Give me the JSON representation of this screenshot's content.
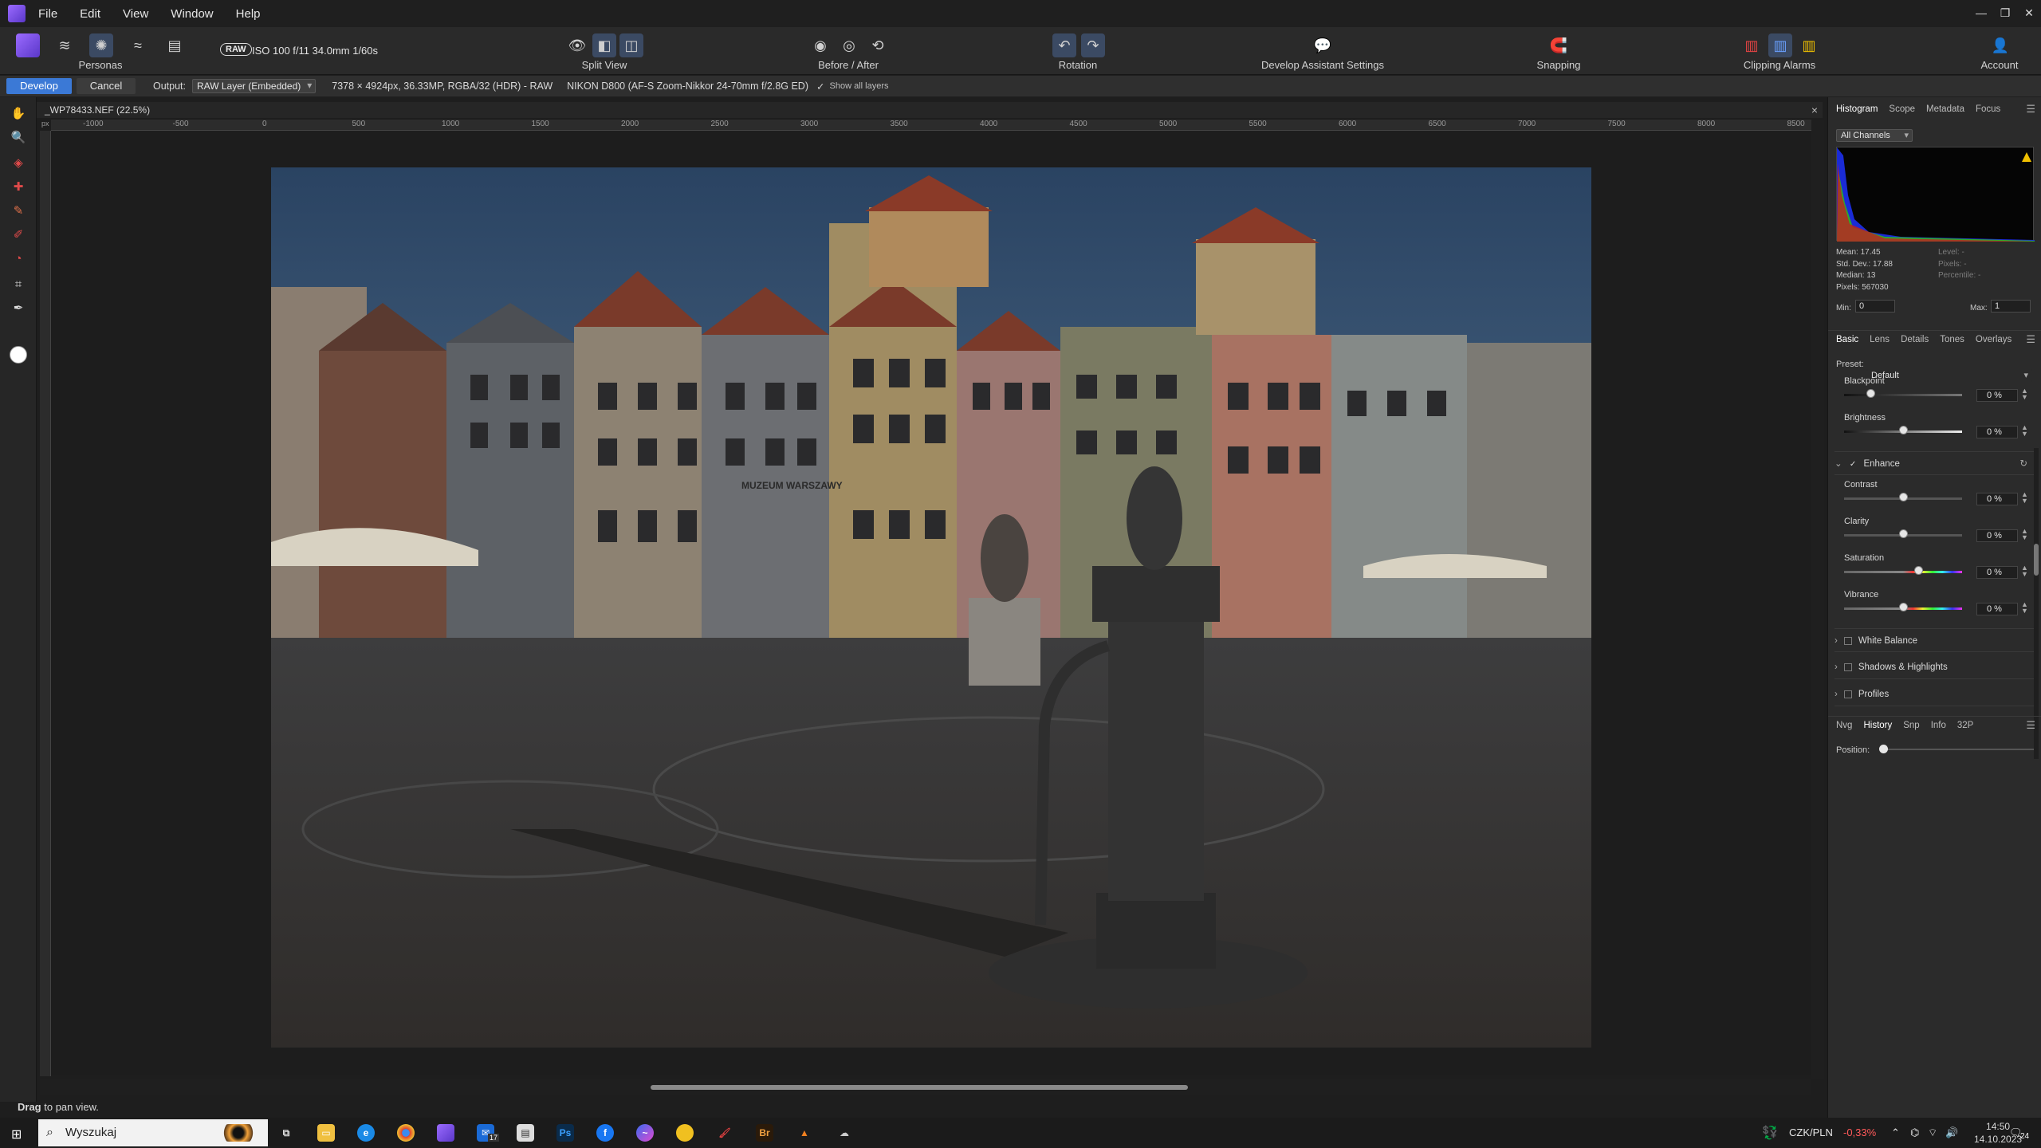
{
  "menubar": {
    "items": [
      "File",
      "Edit",
      "View",
      "Window",
      "Help"
    ]
  },
  "toolbar": {
    "personas_label": "Personas",
    "raw_badge": "RAW",
    "raw_info": "ISO 100 f/11 34.0mm 1/60s",
    "split_view_label": "Split View",
    "before_after_label": "Before / After",
    "rotation_label": "Rotation",
    "assistant_label": "Develop Assistant Settings",
    "snapping_label": "Snapping",
    "clipping_label": "Clipping Alarms",
    "account_label": "Account"
  },
  "context": {
    "develop_label": "Develop",
    "cancel_label": "Cancel",
    "output_label": "Output:",
    "output_value": "RAW Layer (Embedded)",
    "image_info": "7378 × 4924px, 36.33MP, RGBA/32 (HDR) - RAW",
    "camera_info": "NIKON D800 (AF-S Zoom-Nikkor 24-70mm f/2.8G ED)",
    "show_layers_label": "Show all layers"
  },
  "document": {
    "tab_title": "_WP78433.NEF (22.5%)",
    "close_glyph": "×"
  },
  "ruler": {
    "unit": "px",
    "ticks": [
      "-1000",
      "-500",
      "0",
      "500",
      "1000",
      "1500",
      "2000",
      "2500",
      "3000",
      "3500",
      "4000",
      "4500",
      "5000",
      "5500",
      "6000",
      "6500",
      "7000",
      "7500",
      "8000",
      "8500"
    ]
  },
  "photo": {
    "sign_text": "MUZEUM WARSZAWY"
  },
  "status": {
    "bold": "Drag",
    "text": "to pan view."
  },
  "histogram_panel": {
    "tabs": [
      "Histogram",
      "Scope",
      "Metadata",
      "Focus"
    ],
    "channel": "All Channels",
    "stats": [
      "Mean: 17.45",
      "Std. Dev.: 17.88",
      "Median: 13",
      "Pixels: 567030"
    ],
    "stats_right": [
      "Level: -",
      "Pixels: -",
      "Percentile: -"
    ],
    "min_label": "Min:",
    "min_value": "0",
    "max_label": "Max:",
    "max_value": "1"
  },
  "develop_panel": {
    "tabs": [
      "Basic",
      "Lens",
      "Details",
      "Tones",
      "Overlays"
    ],
    "preset_label": "Preset:",
    "preset_value": "Default",
    "blackpoint": {
      "label": "Blackpoint",
      "value": "0 %"
    },
    "brightness": {
      "label": "Brightness",
      "value": "0 %"
    },
    "enhance_label": "Enhance",
    "contrast": {
      "label": "Contrast",
      "value": "0 %"
    },
    "clarity": {
      "label": "Clarity",
      "value": "0 %"
    },
    "saturation": {
      "label": "Saturation",
      "value": "0 %"
    },
    "vibrance": {
      "label": "Vibrance",
      "value": "0 %"
    },
    "white_balance_label": "White Balance",
    "shadows_label": "Shadows & Highlights",
    "profiles_label": "Profiles"
  },
  "history_panel": {
    "tabs": [
      "Nvg",
      "History",
      "Snp",
      "Info",
      "32P"
    ],
    "position_label": "Position:"
  },
  "taskbar": {
    "search_placeholder": "Wyszukaj",
    "currency": "CZK/PLN",
    "change": "-0,33%",
    "time": "14:50",
    "date": "14.10.2023",
    "notif_count": "24",
    "badge": "17"
  },
  "colors": {
    "accent": "#3b79d6",
    "negative": "#ff5a5a"
  }
}
